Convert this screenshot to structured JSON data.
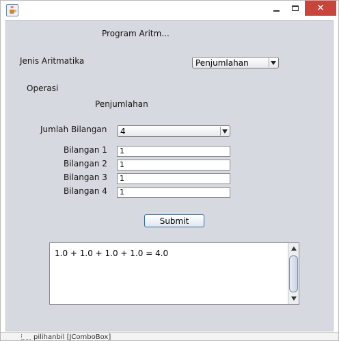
{
  "window": {
    "icon": "java-cup-icon",
    "close_glyph": "✕"
  },
  "form": {
    "title": "Program Aritm...",
    "jenis_label": "Jenis Aritmatika",
    "jenis_value": "Penjumlahan",
    "operasi_label": "Operasi",
    "operasi_value": "Penjumlahan",
    "jumlah_label": "Jumlah Bilangan",
    "jumlah_value": "4",
    "bilangan": [
      {
        "label": "Bilangan 1",
        "value": "1"
      },
      {
        "label": "Bilangan 2",
        "value": "1"
      },
      {
        "label": "Bilangan 3",
        "value": "1"
      },
      {
        "label": "Bilangan 4",
        "value": "1"
      }
    ],
    "submit_label": "Submit",
    "output_text": "1.0 + 1.0 + 1.0 + 1.0 = 4.0"
  },
  "background_fragment": "pilihanbil [JComboBox]",
  "colors": {
    "panel": "#d6d9df",
    "close_button": "#c9443a",
    "button_border": "#2f6aa8"
  }
}
